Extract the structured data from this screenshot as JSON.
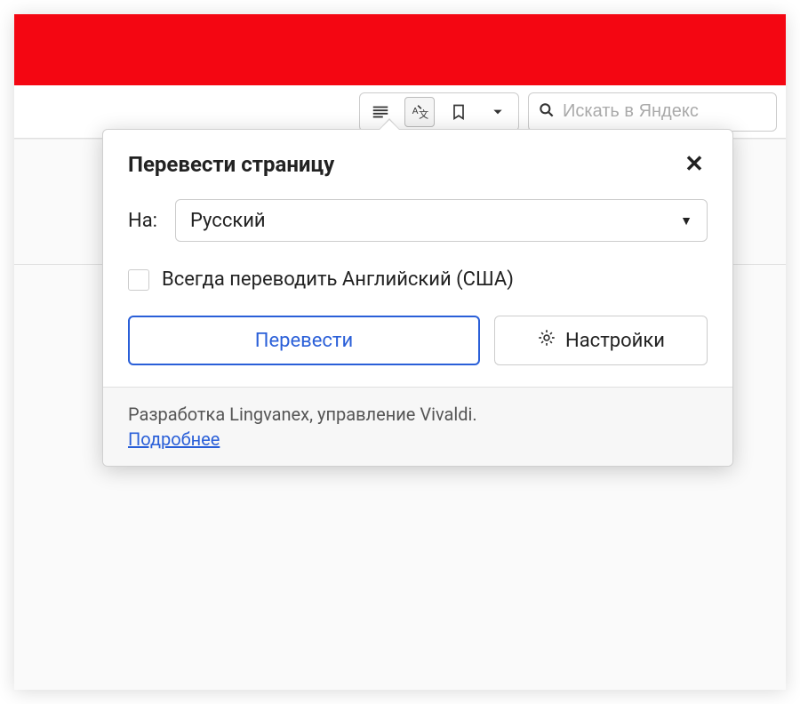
{
  "toolbar": {
    "search_placeholder": "Искать в Яндекс"
  },
  "popover": {
    "title": "Перевести страницу",
    "lang_label": "На:",
    "selected_language": "Русский",
    "always_translate_label": "Всегда переводить Английский (США)",
    "translate_button": "Перевести",
    "settings_button": "Настройки"
  },
  "footer": {
    "credits": "Разработка Lingvanex, управление Vivaldi.",
    "more_link": "Подробнее"
  }
}
